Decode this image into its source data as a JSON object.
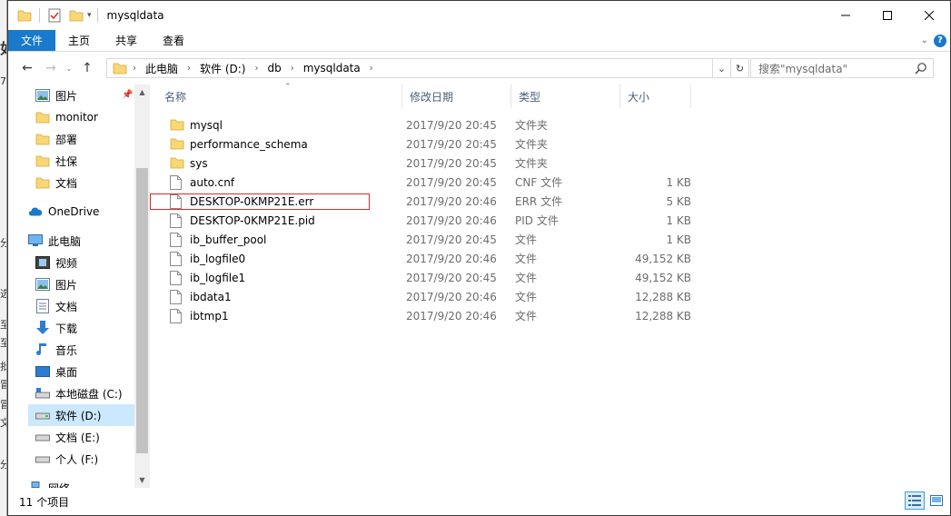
{
  "window": {
    "title": "mysqldata"
  },
  "ribbon": {
    "tabs": [
      "文件",
      "主页",
      "共享",
      "查看"
    ]
  },
  "address": {
    "crumbs": [
      "此电脑",
      "软件 (D:)",
      "db",
      "mysqldata"
    ]
  },
  "search": {
    "placeholder": "搜索\"mysqldata\""
  },
  "nav": {
    "items": [
      {
        "label": "图片",
        "icon": "pictures-icon",
        "pinned": true
      },
      {
        "label": "monitor",
        "icon": "folder-icon"
      },
      {
        "label": "部署",
        "icon": "folder-icon"
      },
      {
        "label": "社保",
        "icon": "folder-icon"
      },
      {
        "label": "文档",
        "icon": "folder-icon"
      },
      {
        "label": "OneDrive",
        "icon": "onedrive-icon"
      },
      {
        "label": "此电脑",
        "icon": "this-pc-icon"
      },
      {
        "label": "视频",
        "icon": "videos-icon"
      },
      {
        "label": "图片",
        "icon": "pictures-icon"
      },
      {
        "label": "文档",
        "icon": "documents-icon"
      },
      {
        "label": "下载",
        "icon": "downloads-icon"
      },
      {
        "label": "音乐",
        "icon": "music-icon"
      },
      {
        "label": "桌面",
        "icon": "desktop-icon"
      },
      {
        "label": "本地磁盘 (C:)",
        "icon": "system-drive-icon"
      },
      {
        "label": "软件 (D:)",
        "icon": "drive-icon",
        "selected": true
      },
      {
        "label": "文档 (E:)",
        "icon": "drive-icon"
      },
      {
        "label": "个人 (F:)",
        "icon": "drive-icon"
      },
      {
        "label": "网络",
        "icon": "network-icon"
      }
    ]
  },
  "columns": {
    "name": "名称",
    "date": "修改日期",
    "type": "类型",
    "size": "大小"
  },
  "files": [
    {
      "name": "mysql",
      "date": "2017/9/20 20:45",
      "type": "文件夹",
      "size": "",
      "icon": "folder-icon"
    },
    {
      "name": "performance_schema",
      "date": "2017/9/20 20:45",
      "type": "文件夹",
      "size": "",
      "icon": "folder-icon"
    },
    {
      "name": "sys",
      "date": "2017/9/20 20:45",
      "type": "文件夹",
      "size": "",
      "icon": "folder-icon"
    },
    {
      "name": "auto.cnf",
      "date": "2017/9/20 20:45",
      "type": "CNF 文件",
      "size": "1 KB",
      "icon": "file-icon"
    },
    {
      "name": "DESKTOP-0KMP21E.err",
      "date": "2017/9/20 20:46",
      "type": "ERR 文件",
      "size": "5 KB",
      "icon": "file-icon",
      "highlighted": true
    },
    {
      "name": "DESKTOP-0KMP21E.pid",
      "date": "2017/9/20 20:46",
      "type": "PID 文件",
      "size": "1 KB",
      "icon": "file-icon"
    },
    {
      "name": "ib_buffer_pool",
      "date": "2017/9/20 20:45",
      "type": "文件",
      "size": "1 KB",
      "icon": "file-icon"
    },
    {
      "name": "ib_logfile0",
      "date": "2017/9/20 20:46",
      "type": "文件",
      "size": "49,152 KB",
      "icon": "file-icon"
    },
    {
      "name": "ib_logfile1",
      "date": "2017/9/20 20:45",
      "type": "文件",
      "size": "49,152 KB",
      "icon": "file-icon"
    },
    {
      "name": "ibdata1",
      "date": "2017/9/20 20:46",
      "type": "文件",
      "size": "12,288 KB",
      "icon": "file-icon"
    },
    {
      "name": "ibtmp1",
      "date": "2017/9/20 20:46",
      "type": "文件",
      "size": "12,288 KB",
      "icon": "file-icon"
    }
  ],
  "status": {
    "count": "11 个项目"
  },
  "colors": {
    "accent": "#1979ca",
    "folder": "#f8d775",
    "selection": "#cce8ff",
    "highlight_box": "#e0282f"
  }
}
